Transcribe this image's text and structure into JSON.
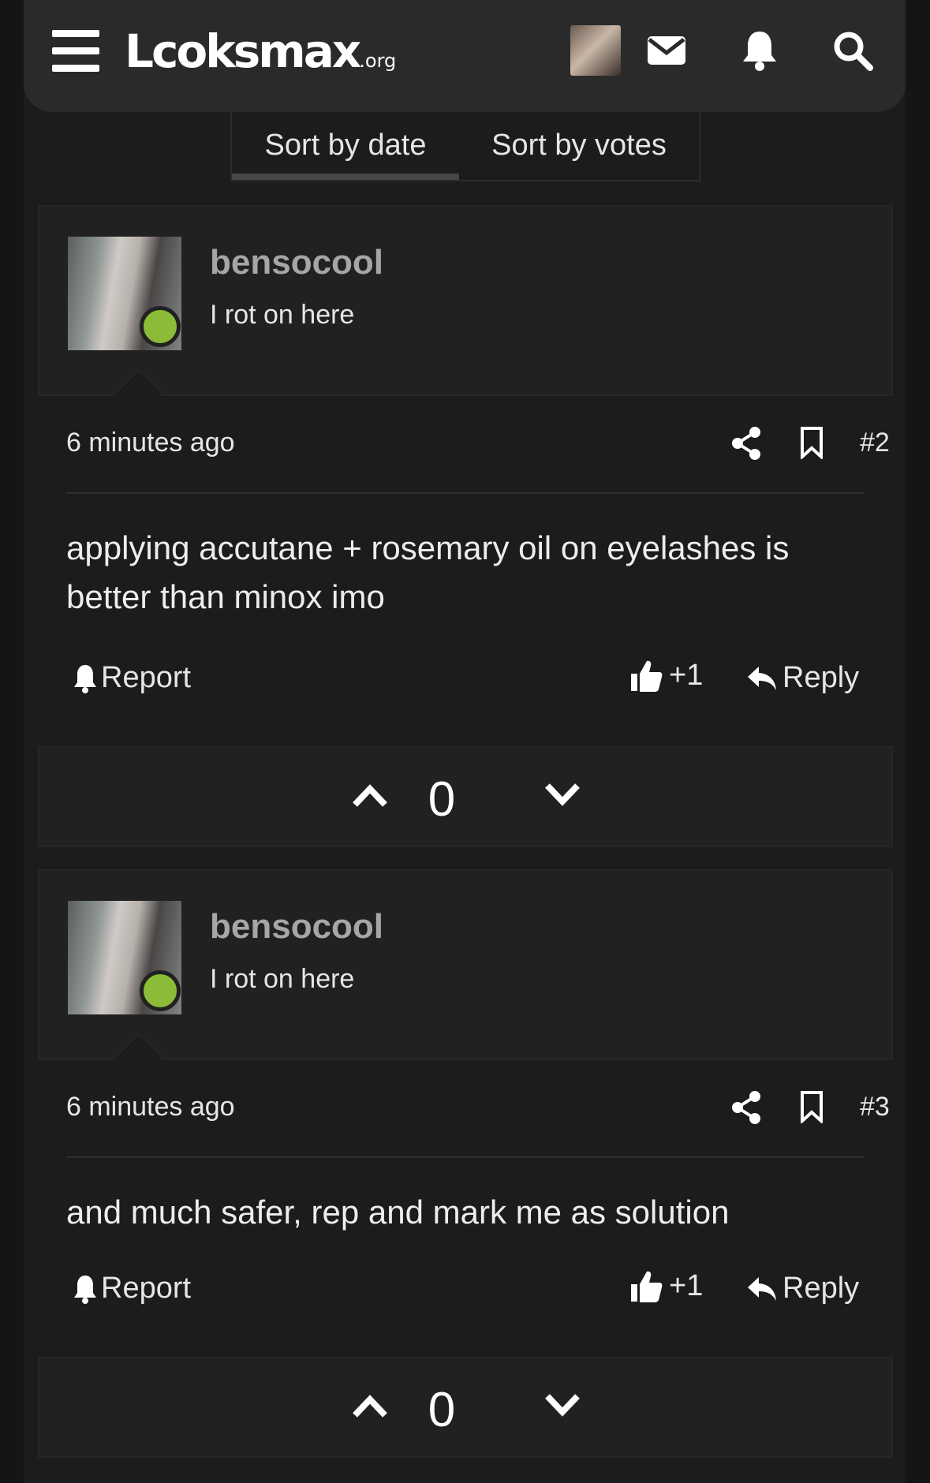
{
  "header": {
    "logo_main": "Lcoksmax",
    "logo_suffix": ".org",
    "icons": [
      "menu-icon",
      "mail-icon",
      "bell-icon",
      "search-icon"
    ]
  },
  "sort": {
    "tabs": [
      "Sort by date",
      "Sort by votes"
    ],
    "active": "Sort by date"
  },
  "posts": [
    {
      "username": "bensocool",
      "user_title": "I rot on here",
      "time": "6 minutes ago",
      "number": "#2",
      "content": "applying accutane + rosemary oil on eyelashes is better than minox imo",
      "report_label": "Report",
      "like_label": "+1",
      "reply_label": "Reply",
      "votes": "0"
    },
    {
      "username": "bensocool",
      "user_title": "I rot on here",
      "time": "6 minutes ago",
      "number": "#3",
      "content": "and much safer, rep and mark me as solution",
      "report_label": "Report",
      "like_label": "+1",
      "reply_label": "Reply",
      "votes": "0"
    }
  ],
  "colors": {
    "background": "#1c1c1c",
    "header": "#2a2a2a",
    "online": "#8cbc37",
    "username": "#a6a6a6"
  }
}
